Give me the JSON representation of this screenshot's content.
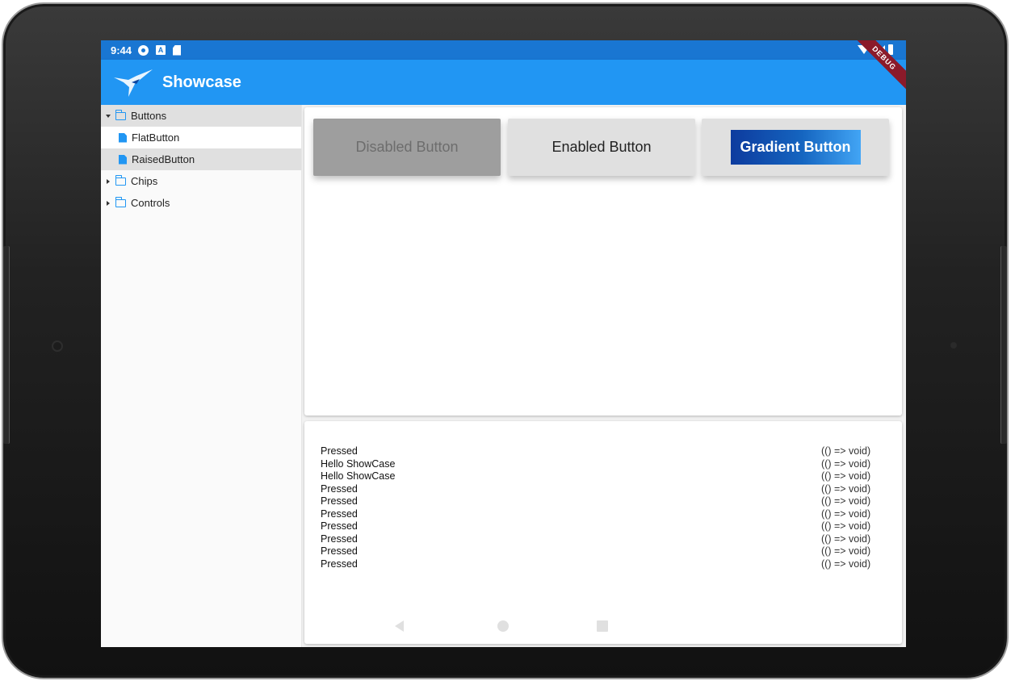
{
  "status_bar": {
    "time": "9:44",
    "left_icons": [
      "gear-icon",
      "a-icon",
      "sd-card-icon"
    ],
    "right_icons": [
      "wifi-icon",
      "signal-icon",
      "battery-icon"
    ]
  },
  "debug_banner": "DEBUG",
  "app_bar": {
    "title": "Showcase",
    "logo": "hummingbird-logo"
  },
  "sidebar": {
    "tree": [
      {
        "label": "Buttons",
        "type": "folder",
        "expanded": true,
        "children": [
          {
            "label": "FlatButton",
            "type": "file",
            "selected": false
          },
          {
            "label": "RaisedButton",
            "type": "file",
            "selected": true
          }
        ]
      },
      {
        "label": "Chips",
        "type": "folder",
        "expanded": false
      },
      {
        "label": "Controls",
        "type": "folder",
        "expanded": false
      }
    ]
  },
  "buttons_panel": {
    "disabled_label": "Disabled Button",
    "enabled_label": "Enabled Button",
    "gradient_label": "Gradient Button"
  },
  "log": {
    "entries": [
      {
        "message": "Pressed",
        "signature": "(() => void)"
      },
      {
        "message": "Hello ShowCase",
        "signature": "(() => void)"
      },
      {
        "message": "Hello ShowCase",
        "signature": "(() => void)"
      },
      {
        "message": "Pressed",
        "signature": "(() => void)"
      },
      {
        "message": "Pressed",
        "signature": "(() => void)"
      },
      {
        "message": "Pressed",
        "signature": "(() => void)"
      },
      {
        "message": "Pressed",
        "signature": "(() => void)"
      },
      {
        "message": "Pressed",
        "signature": "(() => void)"
      },
      {
        "message": "Pressed",
        "signature": "(() => void)"
      },
      {
        "message": "Pressed",
        "signature": "(() => void)"
      }
    ]
  },
  "colors": {
    "status_bar": "#1976d2",
    "app_bar": "#2196f3",
    "accent": "#2196f3",
    "debug_ribbon": "#8b1a2a",
    "gradient_start": "#0d3b9e",
    "gradient_end": "#42a5f5"
  },
  "nav_bar": {
    "icons": [
      "back-icon",
      "home-icon",
      "recents-icon"
    ]
  }
}
